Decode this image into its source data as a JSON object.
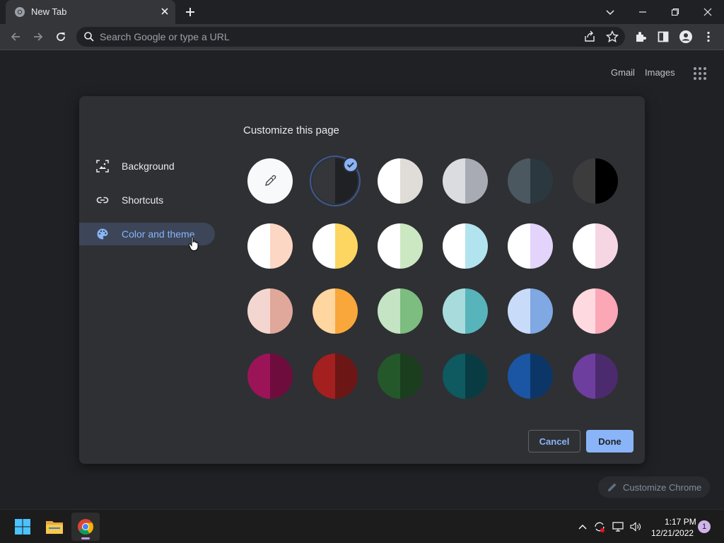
{
  "browser": {
    "tab_title": "New Tab",
    "omnibox_placeholder": "Search Google or type a URL"
  },
  "ntp": {
    "links": [
      "Gmail",
      "Images"
    ],
    "customize_chrome_label": "Customize Chrome"
  },
  "dialog": {
    "title": "Customize this page",
    "nav": [
      {
        "label": "Background",
        "icon": "image-icon"
      },
      {
        "label": "Shortcuts",
        "icon": "link-icon"
      },
      {
        "label": "Color and theme",
        "icon": "palette-icon",
        "active": true
      }
    ],
    "swatches": [
      {
        "name": "custom-color",
        "left": "#f8f9fa",
        "right": "#f8f9fa",
        "picker": true
      },
      {
        "name": "dark-default",
        "left": "#35363a",
        "right": "#202124",
        "selected": true
      },
      {
        "name": "white-warm",
        "left": "#ffffff",
        "right": "#e0dcd8"
      },
      {
        "name": "light-grey",
        "left": "#dadce0",
        "right": "#a8abb4"
      },
      {
        "name": "slate",
        "left": "#4b5860",
        "right": "#2c3840"
      },
      {
        "name": "black",
        "left": "#3c3c3c",
        "right": "#000000"
      },
      {
        "name": "peach-pastel",
        "left": "#ffffff",
        "right": "#fbd7c4"
      },
      {
        "name": "yellow-pastel",
        "left": "#ffffff",
        "right": "#fcd660"
      },
      {
        "name": "green-pastel",
        "left": "#ffffff",
        "right": "#cce8c2"
      },
      {
        "name": "cyan-pastel",
        "left": "#ffffff",
        "right": "#b2e4ef"
      },
      {
        "name": "lavender-pastel",
        "left": "#ffffff",
        "right": "#e4d4fc"
      },
      {
        "name": "pink-pastel",
        "left": "#ffffff",
        "right": "#f7d6e4"
      },
      {
        "name": "rose",
        "left": "#f4d6d0",
        "right": "#e0a89a"
      },
      {
        "name": "orange",
        "left": "#ffd5a0",
        "right": "#f9a73b"
      },
      {
        "name": "green",
        "left": "#c4e4c4",
        "right": "#7dbd80"
      },
      {
        "name": "teal",
        "left": "#a8dcdc",
        "right": "#56b4ba"
      },
      {
        "name": "blue",
        "left": "#c8dcfa",
        "right": "#80a8e2"
      },
      {
        "name": "pink",
        "left": "#ffd9e0",
        "right": "#fba7b6"
      },
      {
        "name": "magenta-dark",
        "left": "#9c1458",
        "right": "#6e0c3e"
      },
      {
        "name": "red-dark",
        "left": "#a41f1f",
        "right": "#6c1616"
      },
      {
        "name": "green-dark",
        "left": "#24582a",
        "right": "#1a3e1e"
      },
      {
        "name": "teal-dark",
        "left": "#0e5a60",
        "right": "#083c42"
      },
      {
        "name": "blue-dark",
        "left": "#1a56a4",
        "right": "#0c3668"
      },
      {
        "name": "purple-dark",
        "left": "#6e3e9e",
        "right": "#4c2a6e"
      }
    ],
    "cancel_label": "Cancel",
    "done_label": "Done"
  },
  "colors": {
    "accent": "#8ab4f8",
    "dialog_bg": "#2f3034",
    "page_bg": "#202124"
  },
  "taskbar": {
    "time": "1:17 PM",
    "date": "12/21/2022",
    "notification_count": "1"
  }
}
